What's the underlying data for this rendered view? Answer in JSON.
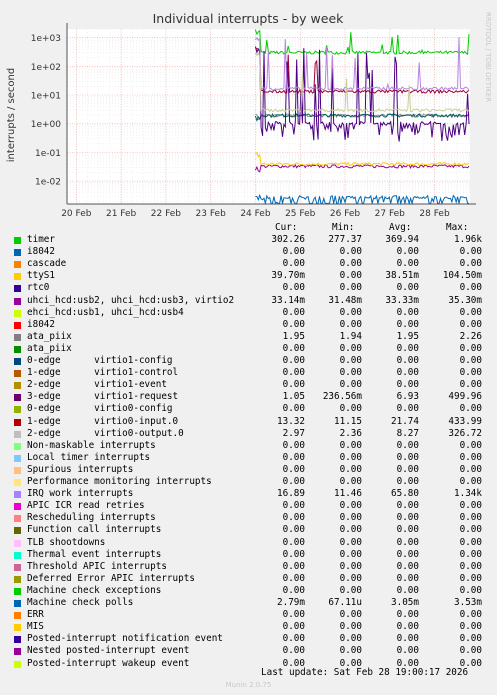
{
  "chart_data": {
    "type": "line",
    "title": "Individual interrupts - by week",
    "ylabel": "interrupts / second",
    "y_scale": "log",
    "ylim": [
      0.0016,
      2000
    ],
    "y_ticks": [
      "1e+03",
      "1e+02",
      "1e+01",
      "1e+00",
      "1e-01",
      "1e-02"
    ],
    "y_tick_values": [
      1000,
      100,
      10,
      1,
      0.1,
      0.01
    ],
    "x_ticks": [
      "20 Feb",
      "21 Feb",
      "22 Feb",
      "23 Feb",
      "24 Feb",
      "25 Feb",
      "26 Feb",
      "27 Feb",
      "28 Feb"
    ],
    "xlim": [
      "2026-02-19T19:00",
      "2026-02-28T19:00"
    ],
    "data_start": "2026-02-24T00:00",
    "grid": true,
    "watermark": "RRDTOOL / TOBI OETIKER",
    "series": [
      {
        "name": "timer",
        "color": "#00cc00",
        "level": 302.26,
        "min": 277.37,
        "max": 1960
      },
      {
        "name": "uhci_hcd:usb2, uhci_hcd:usb3, virtio2",
        "color": "#990099",
        "level": 0.0331,
        "min": 0.0315,
        "max": 0.0353
      },
      {
        "name": "ttyS1",
        "color": "#ffcc00",
        "level": 0.0397,
        "min": 0.0,
        "max": 0.1045
      },
      {
        "name": "ata_piix",
        "color": "#8e8e8e",
        "level": 1.95,
        "min": 1.94,
        "max": 2.26
      },
      {
        "name": "0-edge virtio1-config",
        "color": "#006060",
        "level": 1.95,
        "min": 1.94,
        "max": 1.95
      },
      {
        "name": "3-edge virtio1-request",
        "color": "#4b0082",
        "level": 1.05,
        "min": 0.2366,
        "max": 499.96
      },
      {
        "name": "1-edge virtio0-input.0",
        "color": "#990033",
        "level": 13.32,
        "min": 11.15,
        "max": 433.99
      },
      {
        "name": "IRQ work interrupts",
        "color": "#b784e0",
        "level": 16.89,
        "min": 11.46,
        "max": 1340
      },
      {
        "name": "2-edge virtio0-output.0",
        "color": "#cccc99",
        "level": 2.97,
        "min": 2.36,
        "max": 326.72
      },
      {
        "name": "Machine check polls",
        "color": "#0066b3",
        "level": 0.00279,
        "min": 6.71e-05,
        "max": 0.00353
      }
    ]
  },
  "legend": {
    "headers": {
      "cur": "Cur:",
      "min": "Min:",
      "avg": "Avg:",
      "max": "Max:"
    },
    "rows": [
      {
        "label": "timer",
        "color": "#00cc00",
        "cur": "302.26",
        "min": "277.37",
        "avg": "369.94",
        "max": "1.96k"
      },
      {
        "label": "i8042",
        "color": "#0066b3",
        "cur": "0.00",
        "min": "0.00",
        "avg": "0.00",
        "max": "0.00"
      },
      {
        "label": "cascade",
        "color": "#ff8000",
        "cur": "0.00",
        "min": "0.00",
        "avg": "0.00",
        "max": "0.00"
      },
      {
        "label": "ttyS1",
        "color": "#ffcc00",
        "cur": "39.70m",
        "min": "0.00",
        "avg": "38.51m",
        "max": "104.50m"
      },
      {
        "label": "rtc0",
        "color": "#330099",
        "cur": "0.00",
        "min": "0.00",
        "avg": "0.00",
        "max": "0.00"
      },
      {
        "label": "uhci_hcd:usb2, uhci_hcd:usb3, virtio2",
        "color": "#990099",
        "cur": "33.14m",
        "min": "31.48m",
        "avg": "33.33m",
        "max": "35.30m"
      },
      {
        "label": "ehci_hcd:usb1, uhci_hcd:usb4",
        "color": "#ccff00",
        "cur": "0.00",
        "min": "0.00",
        "avg": "0.00",
        "max": "0.00"
      },
      {
        "label": "i8042",
        "color": "#ff0000",
        "cur": "0.00",
        "min": "0.00",
        "avg": "0.00",
        "max": "0.00"
      },
      {
        "label": "ata_piix",
        "color": "#808080",
        "cur": "1.95",
        "min": "1.94",
        "avg": "1.95",
        "max": "2.26"
      },
      {
        "label": "ata_piix",
        "color": "#008f00",
        "cur": "0.00",
        "min": "0.00",
        "avg": "0.00",
        "max": "0.00"
      },
      {
        "label": "0-edge      virtio1-config",
        "color": "#00487d",
        "cur": "0.00",
        "min": "0.00",
        "avg": "0.00",
        "max": "0.00"
      },
      {
        "label": "1-edge      virtio1-control",
        "color": "#b35a00",
        "cur": "0.00",
        "min": "0.00",
        "avg": "0.00",
        "max": "0.00"
      },
      {
        "label": "2-edge      virtio1-event",
        "color": "#b38f00",
        "cur": "0.00",
        "min": "0.00",
        "avg": "0.00",
        "max": "0.00"
      },
      {
        "label": "3-edge      virtio1-request",
        "color": "#6b006b",
        "cur": "1.05",
        "min": "236.56m",
        "avg": "6.93",
        "max": "499.96"
      },
      {
        "label": "0-edge      virtio0-config",
        "color": "#8fb300",
        "cur": "0.00",
        "min": "0.00",
        "avg": "0.00",
        "max": "0.00"
      },
      {
        "label": "1-edge      virtio0-input.0",
        "color": "#b30000",
        "cur": "13.32",
        "min": "11.15",
        "avg": "21.74",
        "max": "433.99"
      },
      {
        "label": "2-edge      virtio0-output.0",
        "color": "#bebebe",
        "cur": "2.97",
        "min": "2.36",
        "avg": "8.27",
        "max": "326.72"
      },
      {
        "label": "Non-maskable interrupts",
        "color": "#80ff80",
        "cur": "0.00",
        "min": "0.00",
        "avg": "0.00",
        "max": "0.00"
      },
      {
        "label": "Local timer interrupts",
        "color": "#80c9ff",
        "cur": "0.00",
        "min": "0.00",
        "avg": "0.00",
        "max": "0.00"
      },
      {
        "label": "Spurious interrupts",
        "color": "#ffc080",
        "cur": "0.00",
        "min": "0.00",
        "avg": "0.00",
        "max": "0.00"
      },
      {
        "label": "Performance monitoring interrupts",
        "color": "#ffe680",
        "cur": "0.00",
        "min": "0.00",
        "avg": "0.00",
        "max": "0.00"
      },
      {
        "label": "IRQ work interrupts",
        "color": "#aa80ff",
        "cur": "16.89",
        "min": "11.46",
        "avg": "65.80",
        "max": "1.34k"
      },
      {
        "label": "APIC ICR read retries",
        "color": "#ee00cc",
        "cur": "0.00",
        "min": "0.00",
        "avg": "0.00",
        "max": "0.00"
      },
      {
        "label": "Rescheduling interrupts",
        "color": "#ff8080",
        "cur": "0.00",
        "min": "0.00",
        "avg": "0.00",
        "max": "0.00"
      },
      {
        "label": "Function call interrupts",
        "color": "#666600",
        "cur": "0.00",
        "min": "0.00",
        "avg": "0.00",
        "max": "0.00"
      },
      {
        "label": "TLB shootdowns",
        "color": "#ffbfff",
        "cur": "0.00",
        "min": "0.00",
        "avg": "0.00",
        "max": "0.00"
      },
      {
        "label": "Thermal event interrupts",
        "color": "#00ffcc",
        "cur": "0.00",
        "min": "0.00",
        "avg": "0.00",
        "max": "0.00"
      },
      {
        "label": "Threshold APIC interrupts",
        "color": "#cc6699",
        "cur": "0.00",
        "min": "0.00",
        "avg": "0.00",
        "max": "0.00"
      },
      {
        "label": "Deferred Error APIC interrupts",
        "color": "#999900",
        "cur": "0.00",
        "min": "0.00",
        "avg": "0.00",
        "max": "0.00"
      },
      {
        "label": "Machine check exceptions",
        "color": "#00cc00",
        "cur": "0.00",
        "min": "0.00",
        "avg": "0.00",
        "max": "0.00"
      },
      {
        "label": "Machine check polls",
        "color": "#0066b3",
        "cur": "2.79m",
        "min": "67.11u",
        "avg": "3.05m",
        "max": "3.53m"
      },
      {
        "label": "ERR",
        "color": "#ff8000",
        "cur": "0.00",
        "min": "0.00",
        "avg": "0.00",
        "max": "0.00"
      },
      {
        "label": "MIS",
        "color": "#ffcc00",
        "cur": "0.00",
        "min": "0.00",
        "avg": "0.00",
        "max": "0.00"
      },
      {
        "label": "Posted-interrupt notification event",
        "color": "#330099",
        "cur": "0.00",
        "min": "0.00",
        "avg": "0.00",
        "max": "0.00"
      },
      {
        "label": "Nested posted-interrupt event",
        "color": "#990099",
        "cur": "0.00",
        "min": "0.00",
        "avg": "0.00",
        "max": "0.00"
      },
      {
        "label": "Posted-interrupt wakeup event",
        "color": "#ccff00",
        "cur": "0.00",
        "min": "0.00",
        "avg": "0.00",
        "max": "0.00"
      }
    ]
  },
  "footer": {
    "last_update": "Last update: Sat Feb 28 19:00:17 2026",
    "generator": "Munin 2.0.75"
  }
}
